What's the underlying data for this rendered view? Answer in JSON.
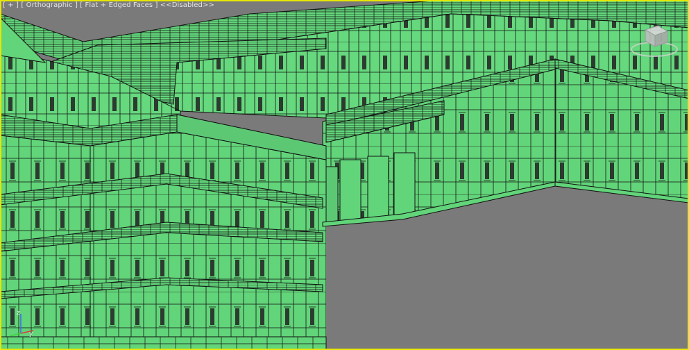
{
  "viewport": {
    "menu_plus": "[ + ]",
    "view_name": "[ Orthographic ]",
    "shading_mode": "[ Flat + Edged Faces ]",
    "status": "<<Disabled>>"
  },
  "gizmo": {
    "z_label": "z",
    "y_label": "y"
  },
  "colors": {
    "mesh": "#62d47a",
    "edge": "#111111",
    "background": "#7a7a7a",
    "active_border": "#e8e800"
  }
}
